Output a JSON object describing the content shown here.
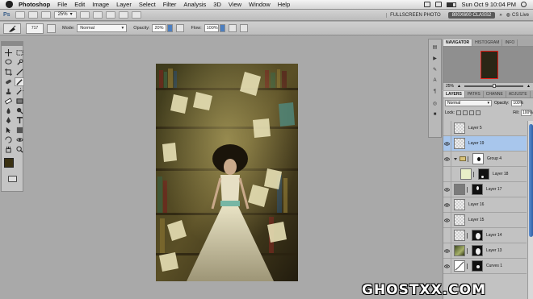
{
  "menubar": {
    "app_name": "Photoshop",
    "menus": [
      "File",
      "Edit",
      "Image",
      "Layer",
      "Select",
      "Filter",
      "Analysis",
      "3D",
      "View",
      "Window",
      "Help"
    ],
    "clock": "Sun Oct 9  10:04 PM"
  },
  "appbar": {
    "ps_badge": "Ps",
    "zoom": "25%",
    "workspace_fullscreen": "FULLSCREEN PHOTO",
    "workspace_active": "800X600 CLASS2",
    "cs_live": "CS Live"
  },
  "options": {
    "brush_size": "717",
    "mode_label": "Mode:",
    "mode_value": "Normal",
    "opacity_label": "Opacity:",
    "opacity_value": "20%",
    "flow_label": "Flow:",
    "flow_value": "100%"
  },
  "navigator": {
    "tabs": [
      "NAVIGATOR",
      "HISTOGRAM",
      "INFO"
    ],
    "zoom": "25%"
  },
  "layers_panel": {
    "tabs": [
      "LAYERS",
      "PATHS",
      "CHANNE",
      "ADJUSTE"
    ],
    "blend_mode": "Normal",
    "opacity_label": "Opacity:",
    "opacity_value": "100%",
    "lock_label": "Lock:",
    "fill_label": "Fill:",
    "fill_value": "100%",
    "layers": [
      {
        "name": "Layer 5"
      },
      {
        "name": "Layer 19"
      },
      {
        "name": "Group 4"
      },
      {
        "name": "Layer 18"
      },
      {
        "name": "Layer 17"
      },
      {
        "name": "Layer 16"
      },
      {
        "name": "Layer 15"
      },
      {
        "name": "Layer 14"
      },
      {
        "name": "Layer 13"
      },
      {
        "name": "Curves 1"
      }
    ]
  },
  "watermark": "GHOSTXX.COM",
  "colors": {
    "foreground": "#3a3112",
    "background": "#ffffff",
    "selection": "#a8c6ec",
    "nav_view_box": "#e0201a"
  }
}
